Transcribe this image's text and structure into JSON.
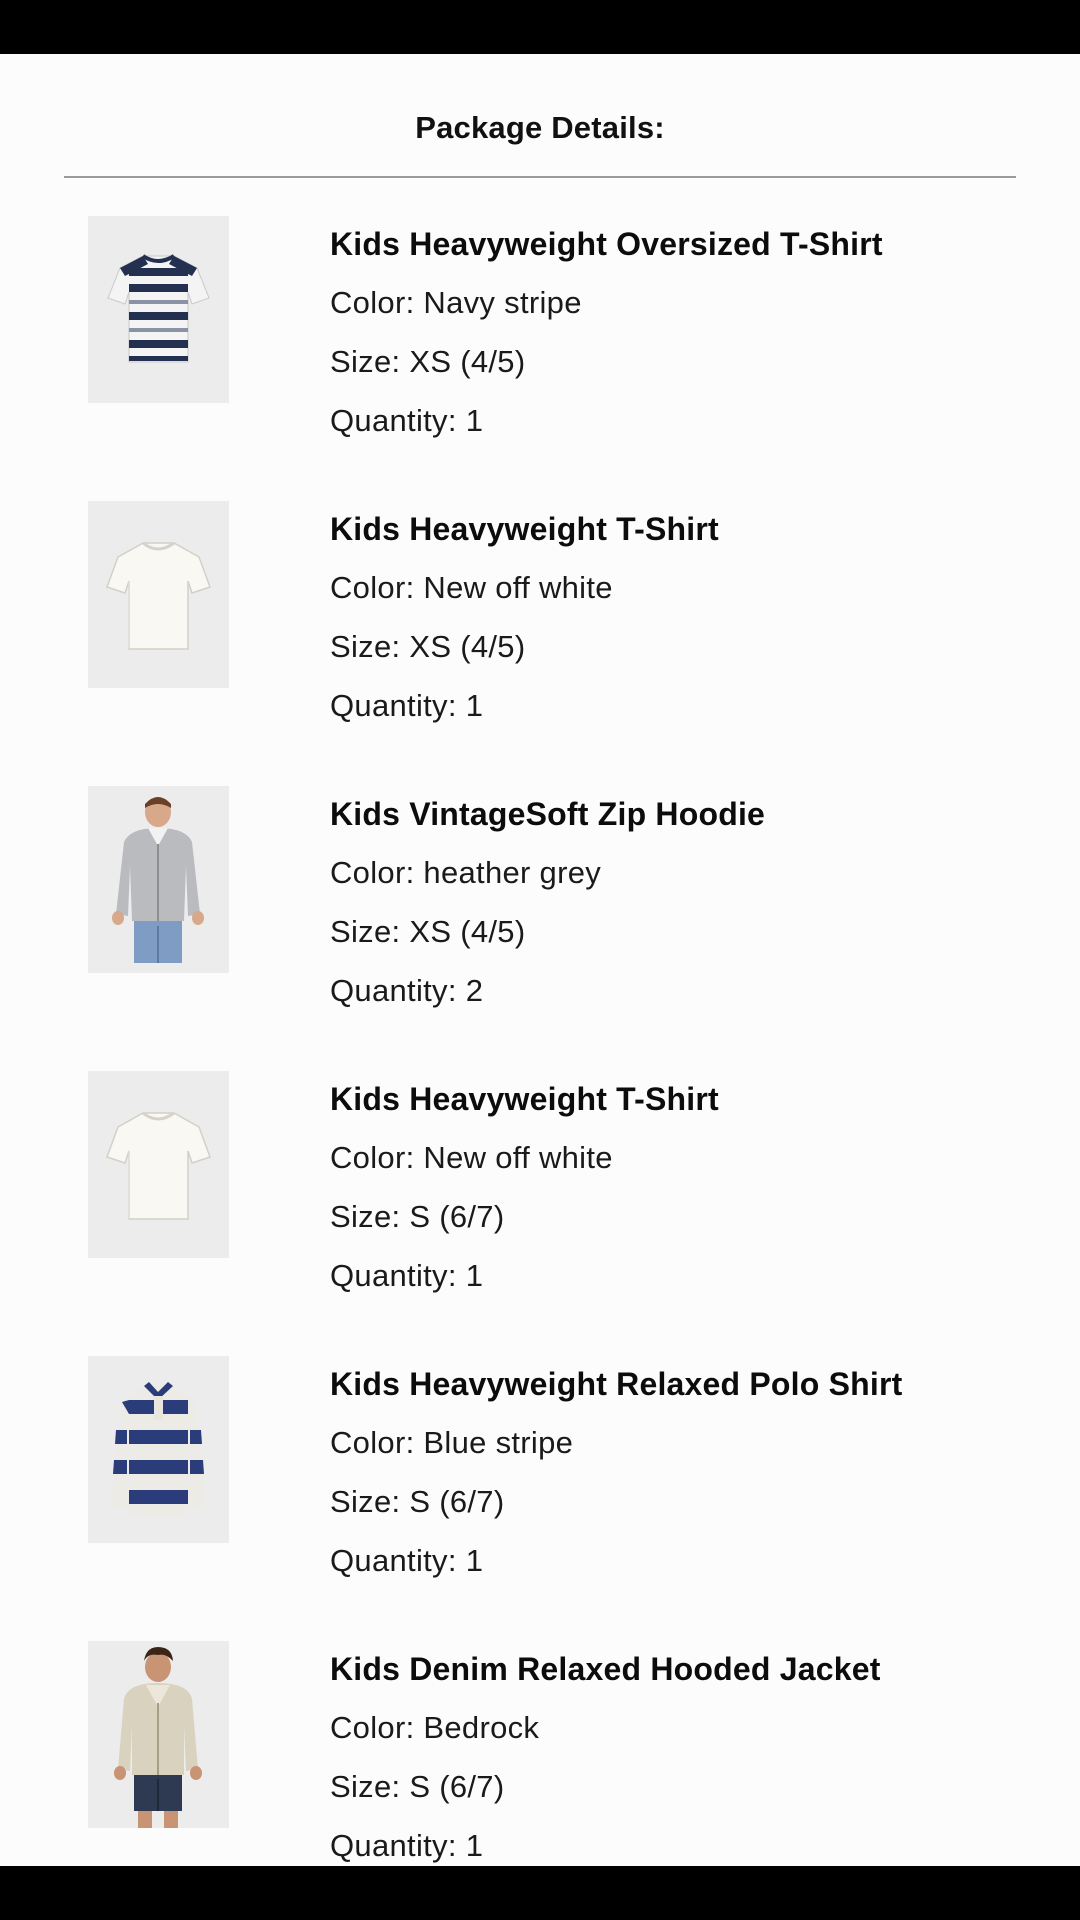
{
  "heading": "Package Details:",
  "labels": {
    "color": "Color: ",
    "size": "Size: ",
    "quantity": "Quantity: "
  },
  "items": [
    {
      "name": "Kids Heavyweight Oversized T-Shirt",
      "color": "Navy stripe",
      "size": "XS (4/5)",
      "quantity": "1",
      "image": "navy-stripe-tshirt"
    },
    {
      "name": "Kids Heavyweight T-Shirt",
      "color": "New off white",
      "size": "XS (4/5)",
      "quantity": "1",
      "image": "off-white-tshirt"
    },
    {
      "name": "Kids VintageSoft Zip Hoodie",
      "color": "heather grey",
      "size": "XS (4/5)",
      "quantity": "2",
      "image": "grey-zip-hoodie-model"
    },
    {
      "name": "Kids Heavyweight T-Shirt",
      "color": "New off white",
      "size": "S (6/7)",
      "quantity": "1",
      "image": "off-white-tshirt"
    },
    {
      "name": "Kids Heavyweight Relaxed Polo Shirt",
      "color": "Blue stripe",
      "size": "S (6/7)",
      "quantity": "1",
      "image": "blue-stripe-polo"
    },
    {
      "name": "Kids Denim Relaxed Hooded Jacket",
      "color": "Bedrock",
      "size": "S (6/7)",
      "quantity": "1",
      "image": "bedrock-jacket-model"
    }
  ],
  "colors": {
    "background": "#fcfcfc",
    "divider": "#9a9a9a",
    "text": "#111111",
    "thumb_bg": "#ececec"
  }
}
